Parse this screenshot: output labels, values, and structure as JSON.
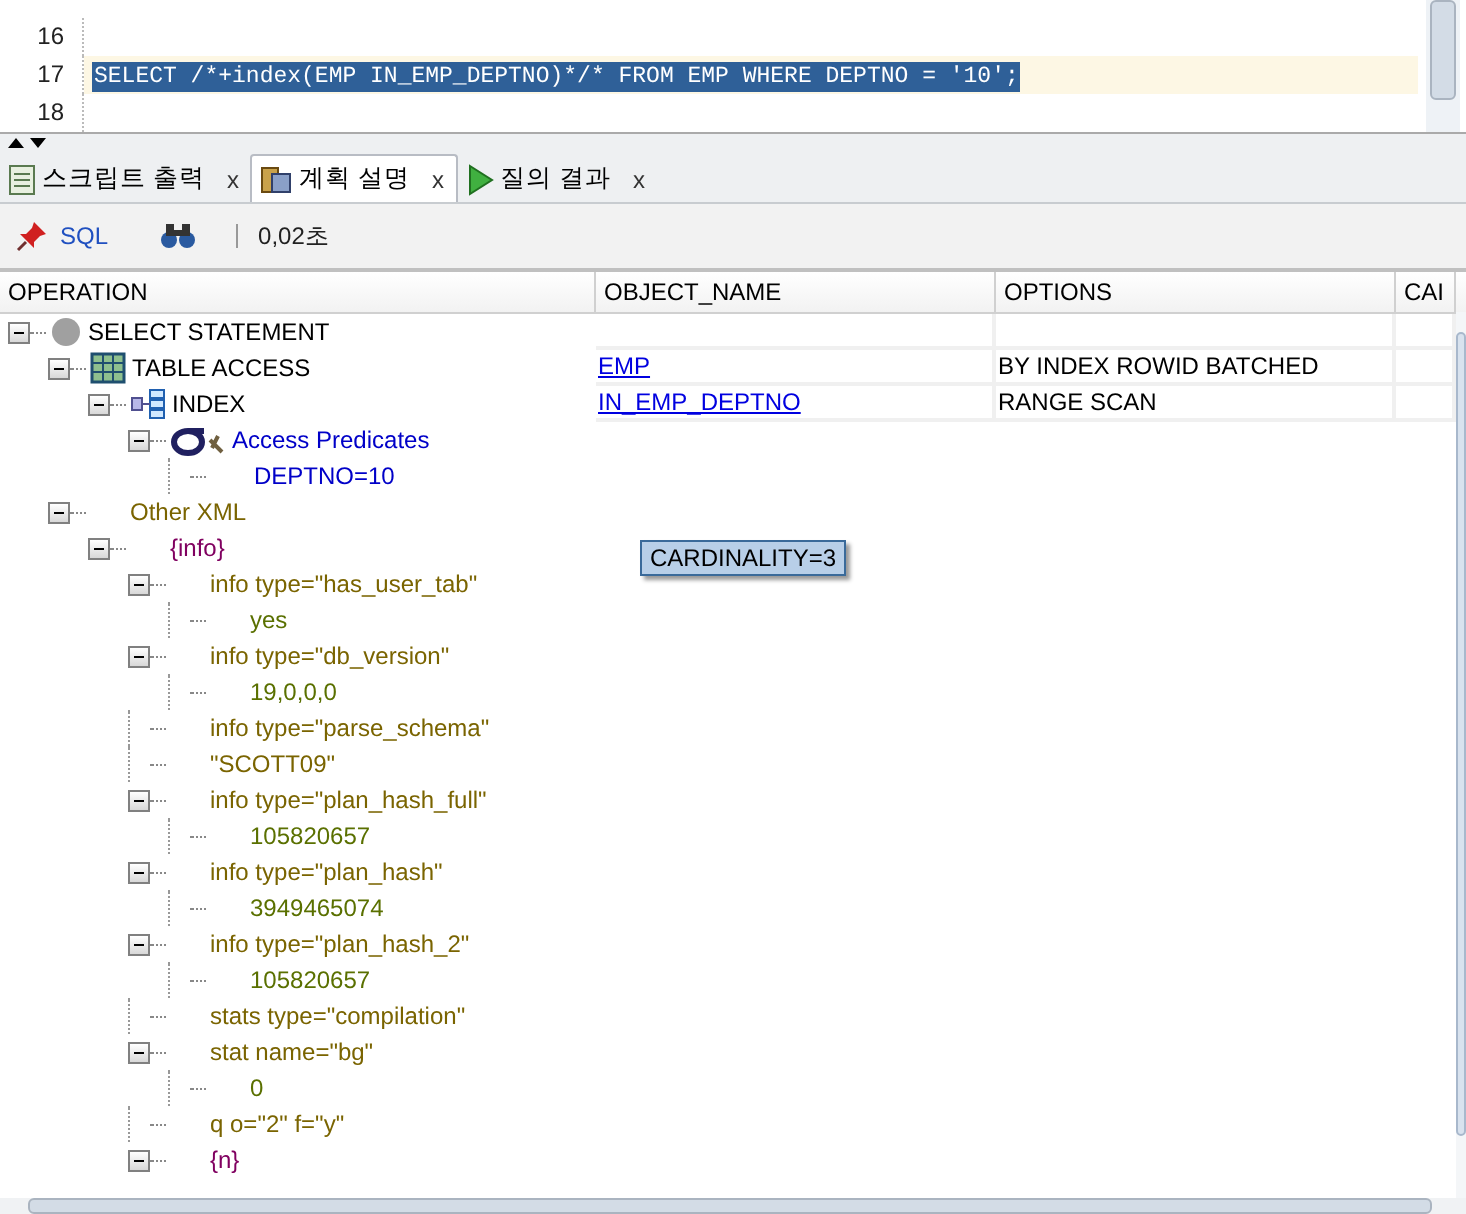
{
  "editor": {
    "lines": [
      {
        "number": "16",
        "selected": false
      },
      {
        "number": "17",
        "code": "SELECT /*+index(EMP IN_EMP_DEPTNO)*/* FROM EMP WHERE DEPTNO = '10';",
        "selected": true
      },
      {
        "number": "18",
        "selected": false
      }
    ]
  },
  "tabs": [
    {
      "label": "스크립트 출력",
      "kind": "script",
      "close": "x",
      "selected": false
    },
    {
      "label": "계획 설명",
      "kind": "plan",
      "close": "x",
      "selected": true
    },
    {
      "label": "질의 결과",
      "kind": "query",
      "close": "x",
      "selected": false
    }
  ],
  "toolbar": {
    "sql_label": "SQL",
    "elapsed": "0,02초"
  },
  "plan": {
    "columns": [
      "OPERATION",
      "OBJECT_NAME",
      "OPTIONS",
      "CAI"
    ],
    "tooltip": "CARDINALITY=3",
    "tree": [
      {
        "label": "SELECT STATEMENT",
        "kind": "statement",
        "expanded": true,
        "children": [
          {
            "label": "TABLE ACCESS",
            "kind": "table_access",
            "object_name": "EMP",
            "options": "BY INDEX ROWID BATCHED",
            "expanded": true,
            "children": [
              {
                "label": "INDEX",
                "kind": "index",
                "object_name": "IN_EMP_DEPTNO",
                "options": "RANGE SCAN",
                "expanded": true,
                "children": [
                  {
                    "label": "Access Predicates",
                    "kind": "predicate",
                    "expanded": true,
                    "children": [
                      {
                        "label": "DEPTNO=10",
                        "kind": "predicate_value"
                      }
                    ]
                  }
                ]
              }
            ]
          },
          {
            "label": "Other XML",
            "kind": "xml_tag",
            "expanded": true,
            "children": [
              {
                "label": "{info}",
                "kind": "xml_group",
                "expanded": true,
                "children": [
                  {
                    "label": "info type=\"has_user_tab\"",
                    "kind": "xml_tag",
                    "expanded": true,
                    "children": [
                      {
                        "label": "yes",
                        "kind": "xml_value"
                      }
                    ]
                  },
                  {
                    "label": "info type=\"db_version\"",
                    "kind": "xml_tag",
                    "expanded": true,
                    "children": [
                      {
                        "label": "19,0,0,0",
                        "kind": "xml_value"
                      }
                    ]
                  },
                  {
                    "label": "info type=\"parse_schema\"",
                    "kind": "xml_tag"
                  },
                  {
                    "label": "\"SCOTT09\"",
                    "kind": "xml_tag"
                  },
                  {
                    "label": "info type=\"plan_hash_full\"",
                    "kind": "xml_tag",
                    "expanded": true,
                    "children": [
                      {
                        "label": "105820657",
                        "kind": "xml_value"
                      }
                    ]
                  },
                  {
                    "label": "info type=\"plan_hash\"",
                    "kind": "xml_tag",
                    "expanded": true,
                    "children": [
                      {
                        "label": "3949465074",
                        "kind": "xml_value"
                      }
                    ]
                  },
                  {
                    "label": "info type=\"plan_hash_2\"",
                    "kind": "xml_tag",
                    "expanded": true,
                    "children": [
                      {
                        "label": "105820657",
                        "kind": "xml_value"
                      }
                    ]
                  },
                  {
                    "label": "stats type=\"compilation\"",
                    "kind": "xml_tag"
                  },
                  {
                    "label": "stat name=\"bg\"",
                    "kind": "xml_tag",
                    "expanded": true,
                    "children": [
                      {
                        "label": "0",
                        "kind": "xml_value"
                      }
                    ]
                  },
                  {
                    "label": "q o=\"2\" f=\"y\"",
                    "kind": "xml_tag"
                  },
                  {
                    "label": "{n}",
                    "kind": "xml_group",
                    "expanded": true
                  }
                ]
              }
            ]
          }
        ]
      }
    ]
  }
}
